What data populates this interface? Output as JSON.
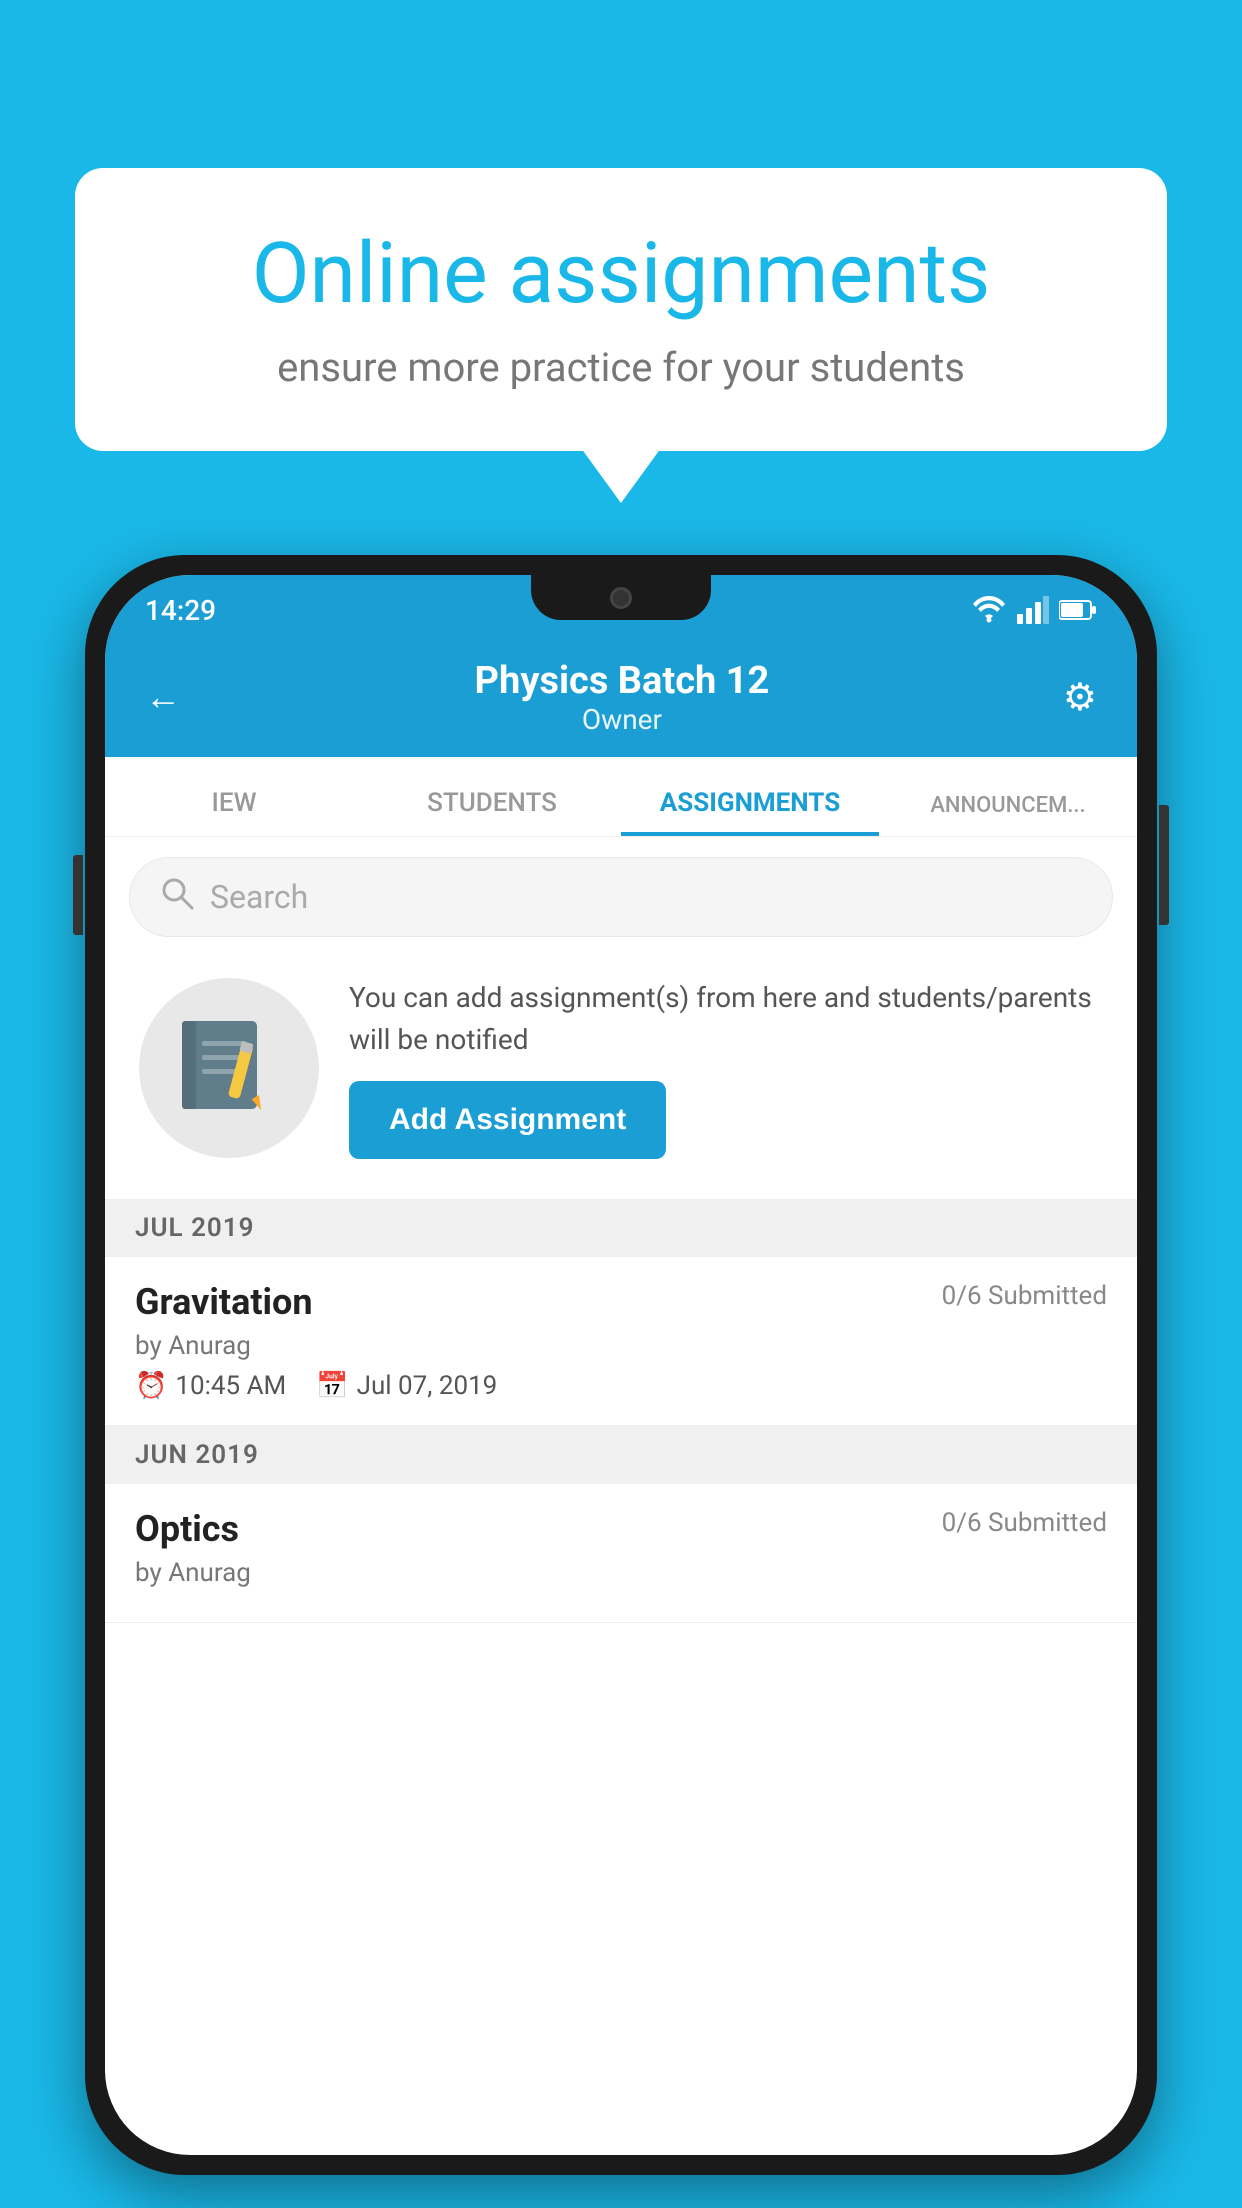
{
  "background": {
    "color": "#1ab8e8"
  },
  "speech_bubble": {
    "title": "Online assignments",
    "subtitle": "ensure more practice for your students"
  },
  "phone": {
    "status_bar": {
      "time": "14:29",
      "wifi": "▾",
      "signal": "▲",
      "battery": "▮"
    },
    "header": {
      "title": "Physics Batch 12",
      "subtitle": "Owner",
      "back_label": "←",
      "settings_label": "⚙"
    },
    "tabs": [
      {
        "label": "IEW",
        "active": false
      },
      {
        "label": "STUDENTS",
        "active": false
      },
      {
        "label": "ASSIGNMENTS",
        "active": true
      },
      {
        "label": "ANNOUNCEM...",
        "active": false
      }
    ],
    "search": {
      "placeholder": "Search"
    },
    "promo": {
      "text": "You can add assignment(s) from here and students/parents will be notified",
      "button_label": "Add Assignment"
    },
    "sections": [
      {
        "header": "JUL 2019",
        "assignments": [
          {
            "name": "Gravitation",
            "submitted": "0/6 Submitted",
            "author": "by Anurag",
            "time": "10:45 AM",
            "date": "Jul 07, 2019"
          }
        ]
      },
      {
        "header": "JUN 2019",
        "assignments": [
          {
            "name": "Optics",
            "submitted": "0/6 Submitted",
            "author": "by Anurag",
            "time": "",
            "date": ""
          }
        ]
      }
    ]
  }
}
